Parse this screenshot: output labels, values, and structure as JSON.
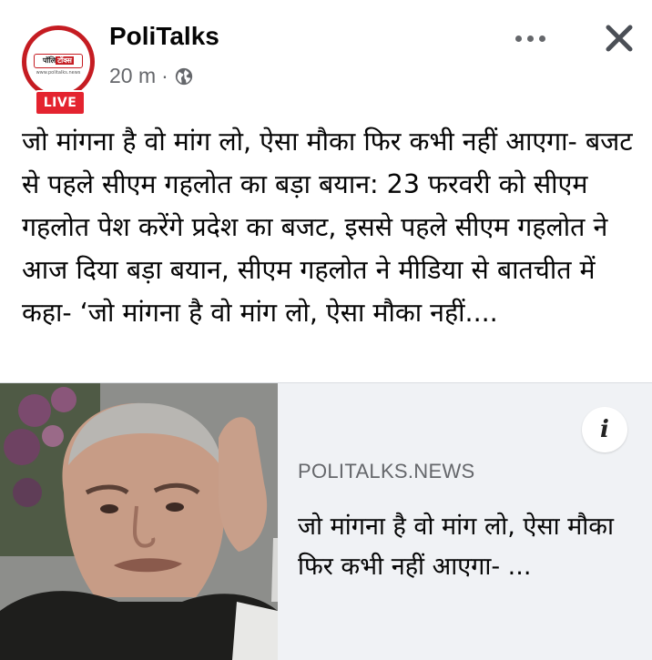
{
  "post": {
    "page_name": "PoliTalks",
    "time": "20 m",
    "separator": "·",
    "live_label": "LIVE",
    "logo_text_left": "पॉलि",
    "logo_text_right": "टॉक्स",
    "logo_url_text": "www.politalks.news",
    "text": "जो मांगना है वो मांग लो, ऐसा मौका फिर कभी नहीं आएगा- बजट से पहले सीएम गहलोत का बड़ा बयान: 23 फरवरी को सीएम गहलोत पेश करेंगे प्रदेश का बजट, इससे पहले सीएम गहलोत ने आज दिया बड़ा बयान, सीएम गहलोत ने मीडिया से बातचीत में कहा- ‘जो मांगना है वो मांग लो, ऐसा मौका नहीं...."
  },
  "link_card": {
    "info_label": "i",
    "domain": "POLITALKS.NEWS",
    "title": "जो मांगना है वो मांग लो, ऐसा मौका फिर कभी नहीं आएगा- ..."
  },
  "icons": {
    "more": "more-options-icon",
    "close": "close-icon",
    "globe": "globe-icon"
  },
  "colors": {
    "live_badge": "#e4232f",
    "brand_red": "#c51c22",
    "secondary_text": "#65676b",
    "card_background": "#f0f2f5"
  }
}
